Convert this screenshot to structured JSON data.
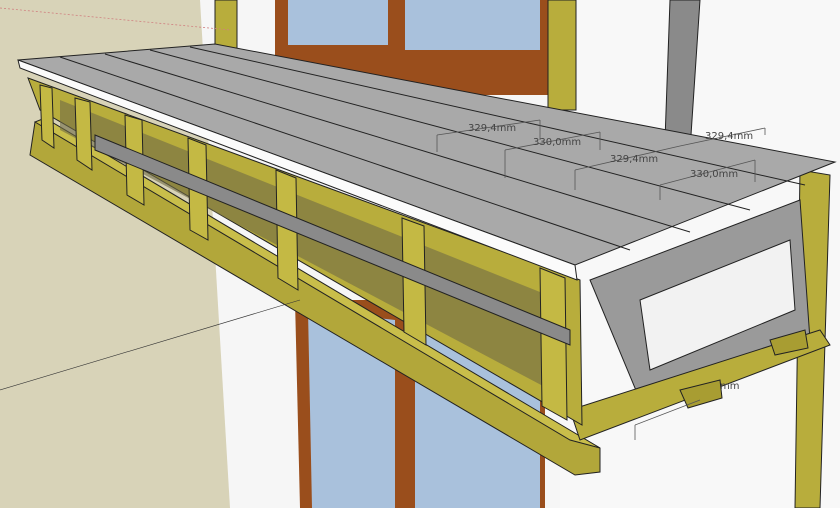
{
  "viewport": {
    "colors": {
      "background_wall": "#d8d3b8",
      "white_wall": "#f7f7f7",
      "window_frame": "#9a4e1c",
      "glass": "#a9c1dc",
      "wood": "#b8ad3c",
      "wood_dark": "#8c8228",
      "roof_sheet": "#a9a9a9",
      "steel": "#8a8a8a"
    },
    "dimensions": [
      {
        "label": "329,4mm"
      },
      {
        "label": "330,0mm"
      },
      {
        "label": "329,4mm"
      },
      {
        "label": "330,0mm"
      },
      {
        "label": "329,4mm"
      },
      {
        "label": "mm"
      }
    ]
  }
}
